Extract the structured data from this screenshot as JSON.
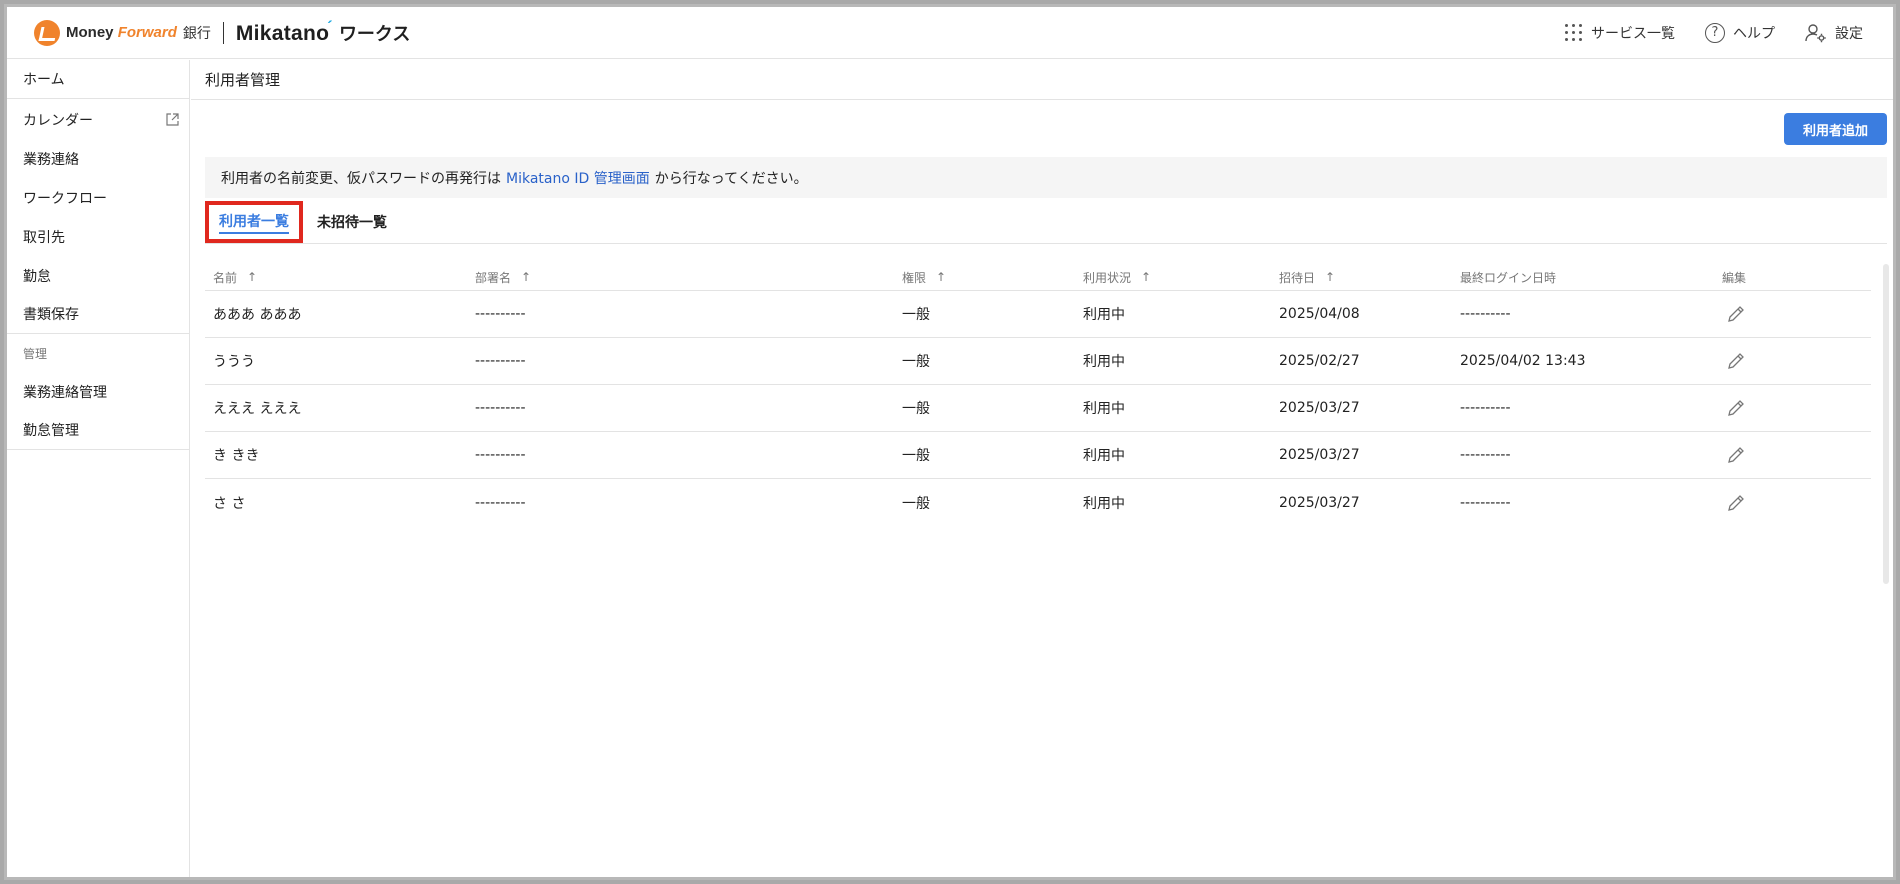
{
  "header": {
    "brand_money": "Money ",
    "brand_forward": "Forward",
    "brand_bank": "銀行",
    "brand_product": "Mikatano",
    "brand_product_suffix": "ワークス",
    "services_label": "サービス一覧",
    "help_label": "ヘルプ",
    "settings_label": "設定"
  },
  "sidebar": {
    "items": [
      {
        "label": "ホーム"
      },
      {
        "label": "カレンダー",
        "icon": "external-link-icon"
      },
      {
        "label": "業務連絡"
      },
      {
        "label": "ワークフロー"
      },
      {
        "label": "取引先"
      },
      {
        "label": "勤怠"
      },
      {
        "label": "書類保存"
      }
    ],
    "section_label": "管理",
    "admin_items": [
      {
        "label": "業務連絡管理"
      },
      {
        "label": "勤怠管理"
      }
    ]
  },
  "main": {
    "page_title": "利用者管理",
    "add_button": "利用者追加",
    "notice_before": "利用者の名前変更、仮パスワードの再発行は",
    "notice_link": "Mikatano ID 管理画面",
    "notice_after": "から行なってください。",
    "tabs": [
      {
        "label": "利用者一覧",
        "active": true
      },
      {
        "label": "未招待一覧",
        "active": false
      }
    ],
    "columns": [
      "名前",
      "部署名",
      "権限",
      "利用状況",
      "招待日",
      "最終ログイン日時",
      "編集"
    ],
    "sort_arrow": "↑",
    "rows": [
      {
        "name": "あああ あああ",
        "dept": "----------",
        "role": "一般",
        "status": "利用中",
        "invited": "2025/04/08",
        "last_login": "----------"
      },
      {
        "name": "ううう",
        "dept": "----------",
        "role": "一般",
        "status": "利用中",
        "invited": "2025/02/27",
        "last_login": "2025/04/02 13:43"
      },
      {
        "name": "えええ えええ",
        "dept": "----------",
        "role": "一般",
        "status": "利用中",
        "invited": "2025/03/27",
        "last_login": "----------"
      },
      {
        "name": "き きき",
        "dept": "----------",
        "role": "一般",
        "status": "利用中",
        "invited": "2025/03/27",
        "last_login": "----------"
      },
      {
        "name": "さ さ",
        "dept": "----------",
        "role": "一般",
        "status": "利用中",
        "invited": "2025/03/27",
        "last_login": "----------"
      }
    ]
  },
  "colors": {
    "accent": "#3b7de0",
    "brand_orange": "#f0832c",
    "highlight_red": "#e0281e",
    "link": "#2a62c9"
  }
}
